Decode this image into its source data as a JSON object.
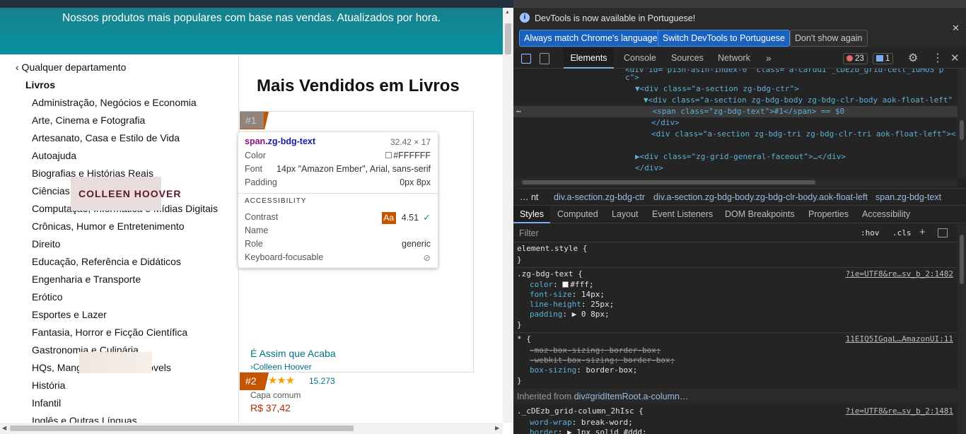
{
  "page": {
    "banner_text": "Nossos produtos mais populares com base nas vendas. Atualizados por hora.",
    "sidebar": {
      "back_link": "‹ Qualquer departamento",
      "current": "Livros",
      "categories": [
        "Administração, Negócios e Economia",
        "Arte, Cinema e Fotografia",
        "Artesanato, Casa e Estilo de Vida",
        "Autoajuda",
        "Biografias e Histórias Reais",
        "Ciências",
        "Computação, Informática e Mídias Digitais",
        "Crônicas, Humor e Entretenimento",
        "Direito",
        "Educação, Referência e Didáticos",
        "Engenharia e Transporte",
        "Erótico",
        "Esportes e Lazer",
        "Fantasia, Horror e Ficção Científica",
        "Gastronomia e Culinária",
        "HQs, Mangás e Graphic Novels",
        "História",
        "Infantil",
        "Inglês e Outras Línguas"
      ]
    },
    "main_title": "Mais Vendidos em Livros",
    "product1": {
      "rank": "#1",
      "cover_author": "COLLEEN HOOVER",
      "title": "É Assim que Acaba",
      "author": "Colleen Hoover",
      "stars": "★★★★★",
      "rating_count": "15.273",
      "format": "Capa comum",
      "price": "R$ 37,42"
    },
    "product2": {
      "rank": "#2"
    }
  },
  "tooltip": {
    "selector_tag": "span",
    "selector_class": ".zg-bdg-text",
    "dimensions": "32.42 × 17",
    "rows": [
      {
        "k": "Color",
        "v": "#FFFFFF"
      },
      {
        "k": "Font",
        "v": "14px \"Amazon Ember\", Arial, sans-serif"
      },
      {
        "k": "Padding",
        "v": "0px 8px"
      }
    ],
    "accessibility_heading": "ACCESSIBILITY",
    "acc_rows": [
      {
        "k": "Contrast",
        "v": "4.51"
      },
      {
        "k": "Name",
        "v": ""
      },
      {
        "k": "Role",
        "v": "generic"
      },
      {
        "k": "Keyboard-focusable",
        "v": ""
      }
    ],
    "contrast_aa": "Aa"
  },
  "devtools": {
    "info_text": "DevTools is now available in Portuguese!",
    "btn_match": "Always match Chrome's language",
    "btn_switch": "Switch DevTools to Portuguese",
    "btn_dont": "Don't show again",
    "tabs": {
      "elements": "Elements",
      "console": "Console",
      "sources": "Sources",
      "network": "Network",
      "more": "»"
    },
    "errors": "23",
    "messages": "1",
    "dom_lines": [
      "<div id=\"p13n-asin-index-0\" class=\"a-cardui _cDEzb_grid-cell_1uMOS p",
      "c\">",
      "▼<div class=\"a-section zg-bdg-ctr\">",
      "▼<div class=\"a-section zg-bdg-body zg-bdg-clr-body aok-float-left\"",
      "<span class=\"zg-bdg-text\">#1</span> == $0",
      "</div>",
      "<div class=\"a-section zg-bdg-tri zg-bdg-clr-tri aok-float-left\"><",
      "▶<div class=\"zg-grid-general-faceout\">…</div>",
      "</div>"
    ],
    "crumbs": [
      "… nt",
      "div.a-section.zg-bdg-ctr",
      "div.a-section.zg-bdg-body.zg-bdg-clr-body.aok-float-left",
      "span.zg-bdg-text"
    ],
    "style_tabs": [
      "Styles",
      "Computed",
      "Layout",
      "Event Listeners",
      "DOM Breakpoints",
      "Properties",
      "Accessibility"
    ],
    "filter_placeholder": "Filter",
    "hov": ":hov",
    "cls": ".cls",
    "rules": {
      "element_style": "element.style {",
      "close": "}",
      "r1_sel": ".zg-bdg-text {",
      "r1_src": "?ie=UTF8&re…sv_b_2:1482",
      "r1_p1": "color",
      "r1_v1": "#fff;",
      "r1_p2": "font-size",
      "r1_v2": "14px;",
      "r1_p3": "line-height",
      "r1_v3": "25px;",
      "r1_p4": "padding",
      "r1_v4": "▶ 0 8px;",
      "r2_sel": "* {",
      "r2_src": "11EIQ5IGqaL…AmazonUI:11",
      "r2_l1": "-moz-box-sizing: border-box;",
      "r2_l2": "-webkit-box-sizing: border-box;",
      "r2_p3": "box-sizing",
      "r2_v3": "border-box;",
      "inherited_label": "Inherited from ",
      "inherited_from": "div#gridItemRoot.a-column…",
      "r3_sel": "._cDEzb_grid-column_2hIsc {",
      "r3_src": "?ie=UTF8&re…sv_b_2:1481",
      "r3_p1": "word-wrap",
      "r3_v1": "break-word;",
      "r3_p2": "border",
      "r3_v2": "▶ 1px solid #ddd;"
    }
  }
}
